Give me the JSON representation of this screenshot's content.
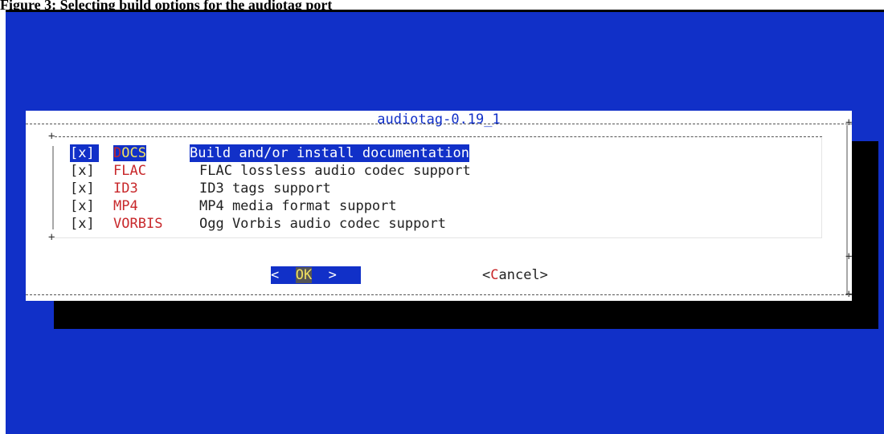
{
  "caption": "Figure 3: Selecting build options for the audiotag port",
  "dialog": {
    "title": "audiotag-0.19_1",
    "options": [
      {
        "checkbox": "[x]",
        "hotkey": "D",
        "rest": "OCS",
        "description": "Build and/or install documentation",
        "selected": true
      },
      {
        "checkbox": "[x]",
        "hotkey": "F",
        "rest": "LAC",
        "description": "FLAC lossless audio codec support",
        "selected": false
      },
      {
        "checkbox": "[x]",
        "hotkey": "I",
        "rest": "D3",
        "description": "ID3 tags support",
        "selected": false
      },
      {
        "checkbox": "[x]",
        "hotkey": "M",
        "rest": "P4",
        "description": "MP4 media format support",
        "selected": false
      },
      {
        "checkbox": "[x]",
        "hotkey": "V",
        "rest": "ORBIS",
        "description": "Ogg Vorbis audio codec support",
        "selected": false
      }
    ],
    "buttons": {
      "ok_left": "<  ",
      "ok_label": "OK",
      "ok_right": "  >",
      "cancel_open": "<",
      "cancel_hotkey": "C",
      "cancel_rest": "ancel>"
    }
  },
  "colors": {
    "background": "#1130c8",
    "hotkey": "#c8282b",
    "selected_tag": "#f0e060"
  }
}
